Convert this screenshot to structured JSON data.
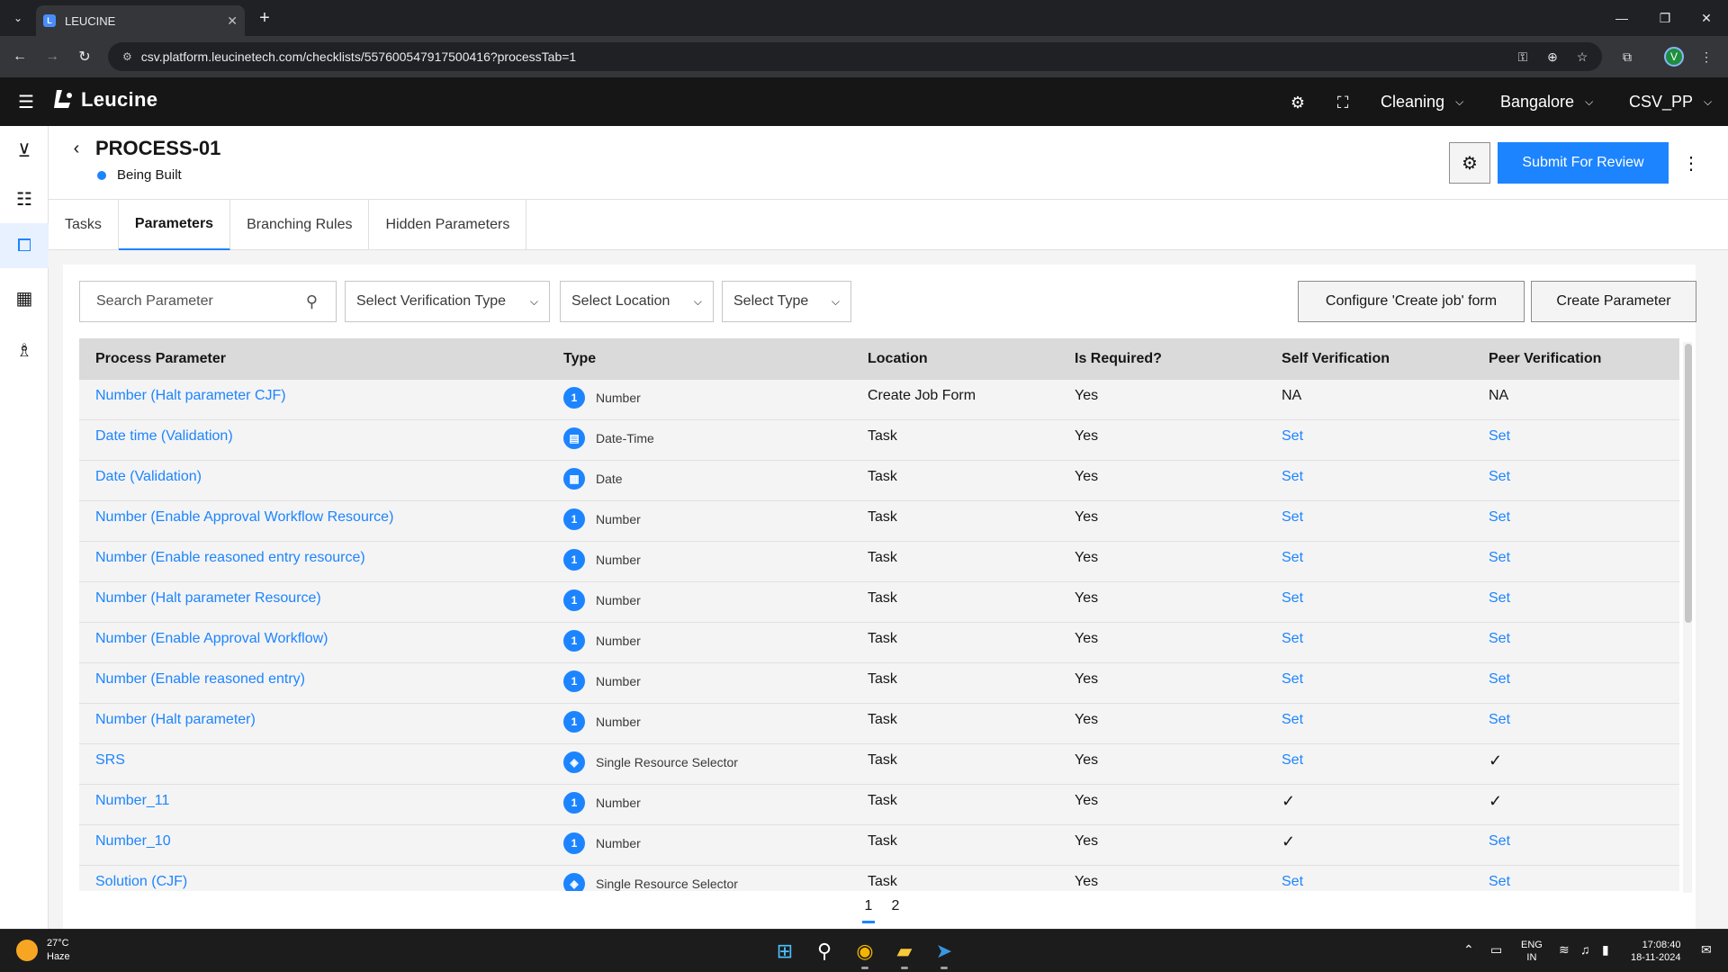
{
  "browser": {
    "tab_title": "LEUCINE",
    "tab_close": "✕",
    "new_tab": "+",
    "url": "csv.platform.leucinetech.com/checklists/557600547917500416?processTab=1"
  },
  "profile_initial": "V",
  "app": {
    "brand": "Leucine",
    "facility_select": "Cleaning",
    "location_select": "Bangalore",
    "org_select": "CSV_PP"
  },
  "process": {
    "title": "PROCESS-01",
    "status": "Being Built",
    "status_color": "#1d84ff",
    "submit_label": "Submit For Review"
  },
  "tabs": [
    {
      "label": "Tasks"
    },
    {
      "label": "Parameters"
    },
    {
      "label": "Branching Rules"
    },
    {
      "label": "Hidden Parameters"
    }
  ],
  "filters": {
    "search_placeholder": "Search Parameter",
    "verification_type": "Select Verification Type",
    "location": "Select Location",
    "type": "Select Type",
    "configure_label": "Configure 'Create job' form",
    "create_label": "Create Parameter"
  },
  "table": {
    "headers": {
      "process_parameter": "Process Parameter",
      "type": "Type",
      "location": "Location",
      "is_required": "Is Required?",
      "self_verification": "Self Verification",
      "peer_verification": "Peer Verification"
    },
    "rows": [
      {
        "name": "Number (Halt parameter CJF)",
        "type": "Number",
        "icon": "number-icon",
        "location": "Create Job Form",
        "required": "Yes",
        "self": "NA",
        "peer": "NA"
      },
      {
        "name": "Date time (Validation)",
        "type": "Date-Time",
        "icon": "datetime-icon",
        "location": "Task",
        "required": "Yes",
        "self": "Set",
        "peer": "Set"
      },
      {
        "name": "Date (Validation)",
        "type": "Date",
        "icon": "calendar-icon",
        "location": "Task",
        "required": "Yes",
        "self": "Set",
        "peer": "Set"
      },
      {
        "name": "Number (Enable Approval Workflow Resource)",
        "type": "Number",
        "icon": "number-icon",
        "location": "Task",
        "required": "Yes",
        "self": "Set",
        "peer": "Set"
      },
      {
        "name": "Number (Enable reasoned entry resource)",
        "type": "Number",
        "icon": "number-icon",
        "location": "Task",
        "required": "Yes",
        "self": "Set",
        "peer": "Set"
      },
      {
        "name": "Number (Halt parameter Resource)",
        "type": "Number",
        "icon": "number-icon",
        "location": "Task",
        "required": "Yes",
        "self": "Set",
        "peer": "Set"
      },
      {
        "name": "Number (Enable Approval Workflow)",
        "type": "Number",
        "icon": "number-icon",
        "location": "Task",
        "required": "Yes",
        "self": "Set",
        "peer": "Set"
      },
      {
        "name": "Number (Enable reasoned entry)",
        "type": "Number",
        "icon": "number-icon",
        "location": "Task",
        "required": "Yes",
        "self": "Set",
        "peer": "Set"
      },
      {
        "name": "Number (Halt parameter)",
        "type": "Number",
        "icon": "number-icon",
        "location": "Task",
        "required": "Yes",
        "self": "Set",
        "peer": "Set"
      },
      {
        "name": "SRS",
        "type": "Single Resource Selector",
        "icon": "resource-selector-icon",
        "location": "Task",
        "required": "Yes",
        "self": "Set",
        "peer": "✓"
      },
      {
        "name": "Number_11",
        "type": "Number",
        "icon": "number-icon",
        "location": "Task",
        "required": "Yes",
        "self": "✓",
        "peer": "✓"
      },
      {
        "name": "Number_10",
        "type": "Number",
        "icon": "number-icon",
        "location": "Task",
        "required": "Yes",
        "self": "✓",
        "peer": "Set"
      },
      {
        "name": "Solution (CJF)",
        "type": "Single Resource Selector",
        "icon": "resource-selector-icon",
        "location": "Task",
        "required": "Yes",
        "self": "Set",
        "peer": "Set"
      }
    ]
  },
  "pagination": {
    "pages": [
      "1",
      "2"
    ],
    "current": "1"
  },
  "taskbar": {
    "temperature": "27°C",
    "weather": "Haze",
    "lang_1": "ENG",
    "lang_2": "IN",
    "time": "17:08:40",
    "date": "18-11-2024"
  }
}
